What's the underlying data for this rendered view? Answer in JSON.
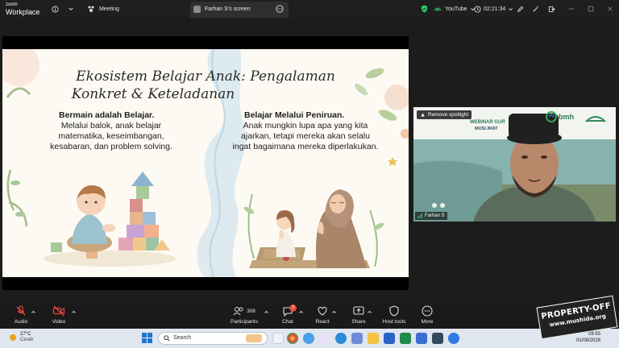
{
  "app": {
    "logo_top": "zoom",
    "logo_bottom": "Workplace",
    "meeting_tab": "Meeting",
    "screen_tab": "Farhan S's screen",
    "stream_label": "YouTube",
    "timer": "02:21:34"
  },
  "slide": {
    "title_line1": "Ekosistem Belajar Anak: Pengalaman",
    "title_line2": "Konkret & Keteladanan",
    "left_heading": "Bermain adalah Belajar.",
    "left_body": [
      "Melalui balok, anak belajar",
      "matematika, keseimbangan,",
      "kesabaran, dan problem solving."
    ],
    "right_heading": "Belajar Melalui Peniruan.",
    "right_body": [
      "Anak mungkin lupa apa yang kita",
      "ajarkan, tetapi mereka akan selalu",
      "ingat bagaimana mereka diperlakukan."
    ]
  },
  "video": {
    "spotlight_label": "Remove spotlight",
    "banner_text_1": "WEBINAR GUR",
    "banner_text_2": "MUSLIMAT",
    "logo_text": "bmh",
    "participant_name": "Farhan S"
  },
  "controls": {
    "audio": "Audio",
    "video": "Video",
    "participants": "Participants",
    "participant_count": "308",
    "chat": "Chat",
    "chat_badge": "3",
    "react": "React",
    "share": "Share",
    "host_tools": "Host tools",
    "more": "More"
  },
  "taskbar": {
    "weather_temp": "27°C",
    "weather_desc": "Cerah",
    "search_placeholder": "Search",
    "time": "09:55",
    "date": "01/08/2026"
  },
  "watermark": {
    "line1": "PROPERTY-OFF",
    "line2": "www.mushida.org"
  },
  "colors": {
    "topbar": "#1f1f1f",
    "stage": "#1c1c1c",
    "slide_bg": "#fdfaf3",
    "accent_green": "#2ecc71",
    "chat_badge": "#e8473c",
    "taskbar": "#dfe6ef"
  }
}
